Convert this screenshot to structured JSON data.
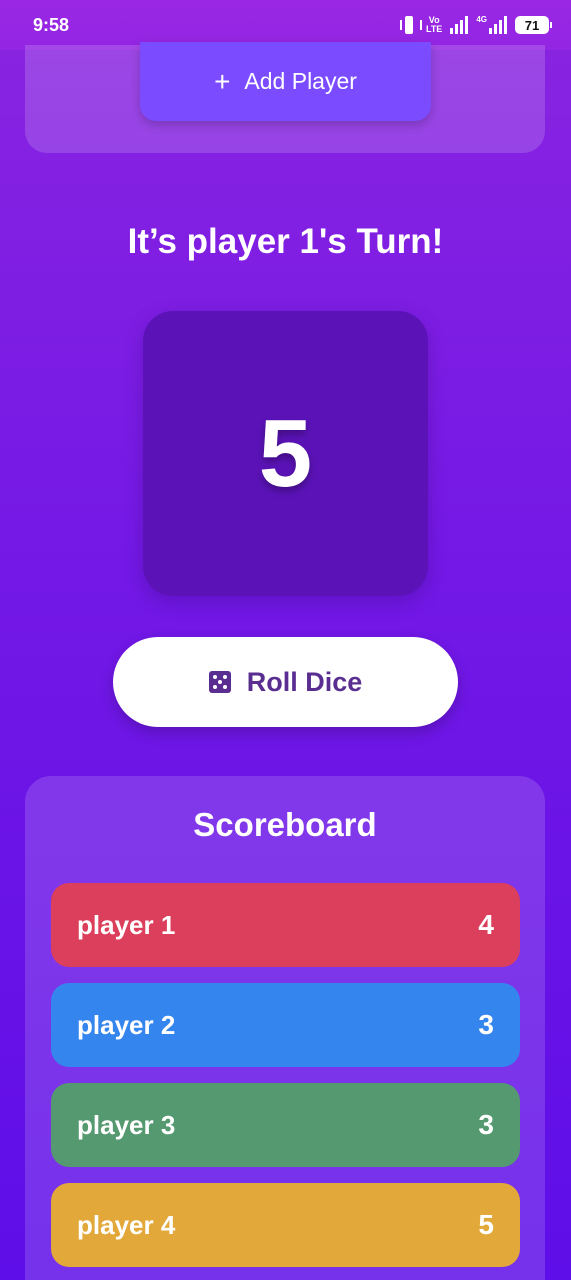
{
  "status_bar": {
    "time": "9:58",
    "battery": "71",
    "volte_top": "Vo",
    "volte_bottom": "LTE",
    "network": "4G"
  },
  "top_panel": {
    "add_player_label": "Add Player"
  },
  "turn_title": "It’s player 1's Turn!",
  "dice": {
    "value": "5"
  },
  "roll_button": {
    "label": "Roll Dice"
  },
  "scoreboard": {
    "title": "Scoreboard",
    "rows": [
      {
        "name": "player 1",
        "score": "4",
        "color": "#dc3f5b"
      },
      {
        "name": "player 2",
        "score": "3",
        "color": "#3585ee"
      },
      {
        "name": "player 3",
        "score": "3",
        "color": "#559970"
      },
      {
        "name": "player 4",
        "score": "5",
        "color": "#e2a83a"
      }
    ]
  }
}
